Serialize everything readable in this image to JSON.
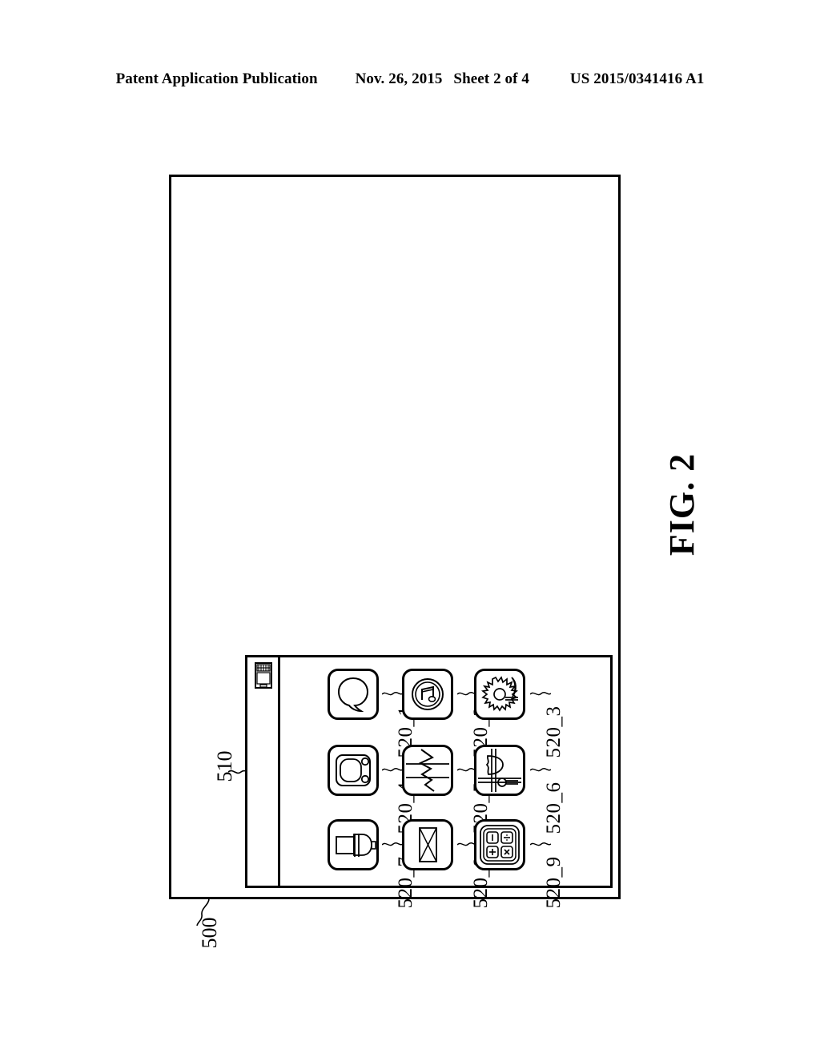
{
  "header": {
    "publication": "Patent Application Publication",
    "date": "Nov. 26, 2015",
    "sheet": "Sheet 2 of 4",
    "patent_number": "US 2015/0341416 A1"
  },
  "figure": {
    "caption": "FIG. 2",
    "reference_numerals": {
      "device": "500",
      "display": "510"
    }
  },
  "device": {
    "name": "mobile-terminal",
    "earpiece": "speaker-grille",
    "icons": [
      {
        "ref": "520_1",
        "icon": "speech-bubble-icon",
        "name": "messages"
      },
      {
        "ref": "520_2",
        "icon": "music-note-icon",
        "name": "music-player"
      },
      {
        "ref": "520_3",
        "icon": "sun-moon-icon",
        "name": "weather"
      },
      {
        "ref": "520_4",
        "icon": "camera-icon",
        "name": "camera"
      },
      {
        "ref": "520_5",
        "icon": "zigzag-chart-icon",
        "name": "chart"
      },
      {
        "ref": "520_6",
        "icon": "settings-slider-icon",
        "name": "settings"
      },
      {
        "ref": "520_7",
        "icon": "flashlight-icon",
        "name": "flashlight"
      },
      {
        "ref": "520_8",
        "icon": "envelope-icon",
        "name": "mail"
      },
      {
        "ref": "520_9",
        "icon": "calculator-icon",
        "name": "calculator"
      }
    ],
    "calculator_keys": [
      "−",
      "÷",
      "+",
      "×"
    ]
  },
  "colors": {
    "line": "#000000",
    "background": "#ffffff"
  }
}
